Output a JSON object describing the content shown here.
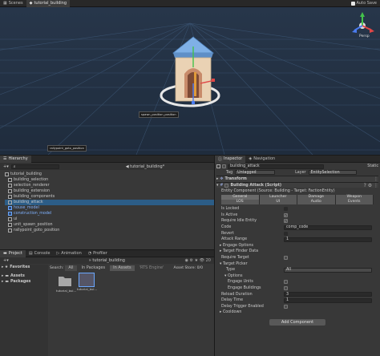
{
  "scene": {
    "tabs": [
      "Scenes",
      "tutorial_building"
    ],
    "auto_save": "Auto Save",
    "persp": "Persp",
    "object_labels": [
      "spawn_position_position",
      "rallypoint_goto_position"
    ]
  },
  "hierarchy": {
    "title": "Hierarchy",
    "scene_name": "tutorial_building*",
    "items": [
      {
        "label": "tutorial_building",
        "indent": 0,
        "blue": false
      },
      {
        "label": "building_selection",
        "indent": 1,
        "blue": false
      },
      {
        "label": "selection_renderer",
        "indent": 1,
        "blue": false
      },
      {
        "label": "building_extension",
        "indent": 1,
        "blue": false
      },
      {
        "label": "building_components",
        "indent": 1,
        "blue": false
      },
      {
        "label": "building_attack",
        "indent": 1,
        "blue": false
      },
      {
        "label": "house_model",
        "indent": 1,
        "blue": true
      },
      {
        "label": "construction_model",
        "indent": 1,
        "blue": true
      },
      {
        "label": "ui",
        "indent": 1,
        "blue": false
      },
      {
        "label": "unit_spawn_position",
        "indent": 1,
        "blue": false
      },
      {
        "label": "rallypoint_goto_position",
        "indent": 1,
        "blue": false
      }
    ]
  },
  "project": {
    "tabs": [
      "Project",
      "Console",
      "Animation",
      "Profiler"
    ],
    "path": "tutorial_building",
    "favorites": "Favorites",
    "tree": [
      "Assets",
      "Packages"
    ],
    "search_label": "Search:",
    "search_scopes": [
      "All",
      "In Packages",
      "In Assets",
      "'RTS Engine'"
    ],
    "asset_store": "Asset Store: 0/0",
    "assets": [
      "tutorial_bui...",
      "tutorial_bui..."
    ],
    "counter": "20"
  },
  "inspector": {
    "tabs": [
      "Inspector",
      "Navigation"
    ],
    "object_name": "building_attack",
    "static": "Static",
    "tag_label": "Tag",
    "tag_value": "Untagged",
    "layer_label": "Layer",
    "layer_value": "EntitySelection",
    "transform": "Transform",
    "component": "Building Attack (Script)",
    "entity_component": "Entity Component (Source: Building - Target: FactionEntity)",
    "tab_row1": [
      "General",
      "Launcher",
      "Damage",
      "Weapon"
    ],
    "tab_row2": [
      "LOS",
      "UI",
      "Audio",
      "Events"
    ],
    "fields": [
      {
        "label": "Is Locked",
        "type": "check",
        "on": false
      },
      {
        "label": "Is Active",
        "type": "check",
        "on": true
      },
      {
        "label": "Require Idle Entity",
        "type": "check",
        "on": true
      },
      {
        "label": "Code",
        "type": "text",
        "value": "comp_code"
      },
      {
        "label": "Revert",
        "type": "check",
        "on": false
      },
      {
        "label": "Attack Range",
        "type": "text",
        "value": "1"
      }
    ],
    "sections": {
      "engage_options": "Engage Options",
      "target_finder": "Target Finder Data",
      "require_target": "Require Target",
      "target_picker": "Target Picker",
      "type_label": "Type",
      "type_value": "All",
      "options": "Options",
      "engage_units": "Engage Units",
      "engage_buildings": "Engage Buildings",
      "reload_duration": "Reload Duration",
      "reload_value": "3",
      "delay_time": "Delay Time",
      "delay_value": "1",
      "delay_trigger": "Delay Trigger Enabled",
      "cooldown": "Cooldown"
    },
    "add_component": "Add Component"
  },
  "colors": {
    "scene_bg": "#1e2a39",
    "selection": "#2c5d87",
    "panel": "#383838"
  }
}
